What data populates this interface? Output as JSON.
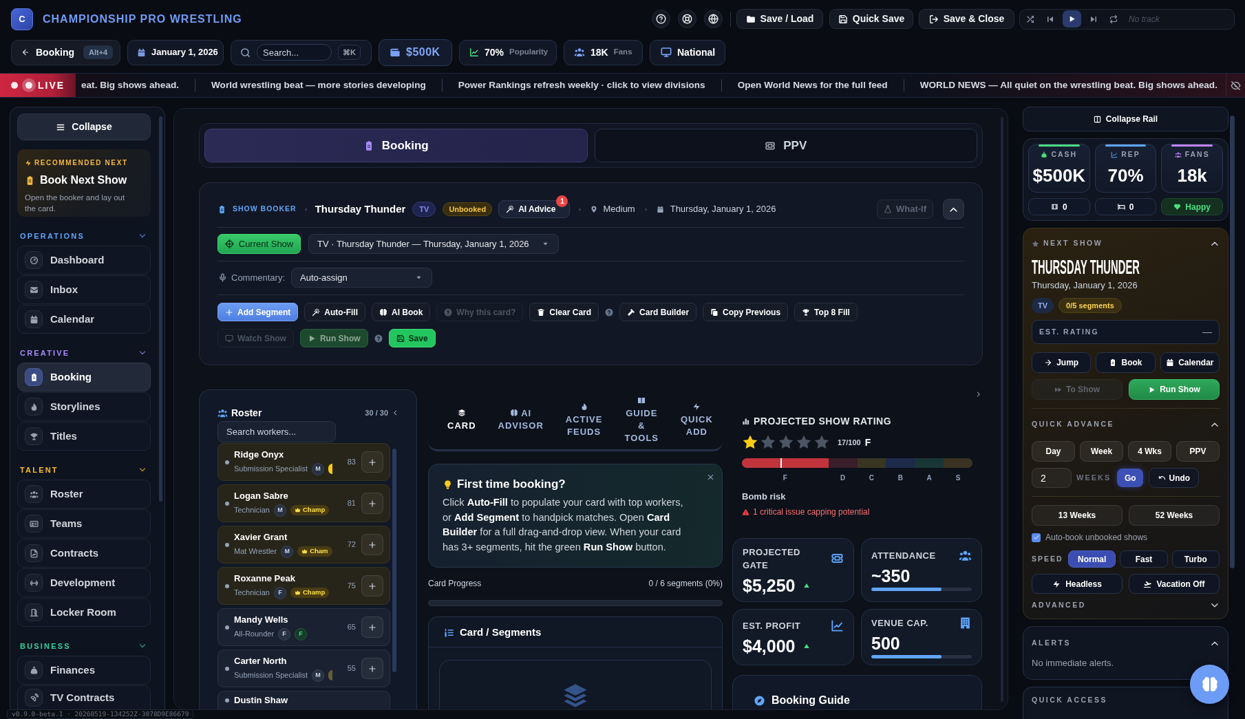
{
  "app": {
    "logo": "C",
    "title": "CHAMPIONSHIP PRO WRESTLING"
  },
  "toolbar": {
    "buttons": [
      {
        "label": "Save / Load"
      },
      {
        "label": "Quick Save"
      },
      {
        "label": "Save & Close"
      }
    ],
    "player": {
      "track": "No track"
    }
  },
  "nav": {
    "back": {
      "label": "Booking",
      "shortcut": "Alt+4"
    },
    "date": "January 1, 2026",
    "search": {
      "placeholder": "Search...",
      "shortcut": "⌘K"
    },
    "stats": [
      {
        "kind": "cash",
        "value": "$500K"
      },
      {
        "kind": "popularity",
        "value": "70%",
        "label": "Popularity"
      },
      {
        "kind": "fans",
        "value": "18K",
        "label": "Fans"
      },
      {
        "kind": "reach",
        "value": "National"
      }
    ]
  },
  "ticker": {
    "live": "LIVE",
    "items": [
      "eat. Big shows ahead.",
      "World wrestling beat — more stories developing",
      "Power Rankings refresh weekly · click to view divisions",
      "Open World News for the full feed",
      "WORLD NEWS — All quiet on the wrestling beat. Big shows ahead."
    ]
  },
  "sidebar": {
    "collapse": "Collapse",
    "recommended": {
      "eyebrow": "RECOMMENDED NEXT",
      "title": "Book Next Show",
      "text": "Open the booker and lay out the card."
    },
    "sections": [
      {
        "title": "OPERATIONS",
        "color": "#60a5fa",
        "items": [
          {
            "label": "Dashboard",
            "selected": false
          },
          {
            "label": "Inbox",
            "selected": false
          },
          {
            "label": "Calendar",
            "selected": false
          }
        ]
      },
      {
        "title": "CREATIVE",
        "color": "#a78bfa",
        "items": [
          {
            "label": "Booking",
            "selected": true
          },
          {
            "label": "Storylines",
            "selected": false
          },
          {
            "label": "Titles",
            "selected": false
          }
        ]
      },
      {
        "title": "TALENT",
        "color": "#fbbf24",
        "items": [
          {
            "label": "Roster",
            "selected": false
          },
          {
            "label": "Teams",
            "selected": false
          },
          {
            "label": "Contracts",
            "selected": false
          },
          {
            "label": "Development",
            "selected": false
          },
          {
            "label": "Locker Room",
            "selected": false
          }
        ]
      },
      {
        "title": "BUSINESS",
        "color": "#34d399",
        "items": [
          {
            "label": "Finances",
            "selected": false
          },
          {
            "label": "TV Contracts",
            "selected": false
          }
        ]
      }
    ],
    "version": "v0.9.0-beta.1 · 20260519-134252Z-3078D9E86679"
  },
  "main_tabs": [
    {
      "label": "Booking",
      "selected": true
    },
    {
      "label": "PPV",
      "selected": false
    }
  ],
  "show_booker": {
    "title": "SHOW BOOKER",
    "show_name": "Thursday Thunder",
    "type_badge": "TV",
    "status_badge": "Unbooked",
    "ai_advice": {
      "label": "AI Advice",
      "count": "1"
    },
    "venue": "Medium",
    "date": "Thursday, January 1, 2026",
    "what_if": "What-If",
    "expanded": true,
    "current_show": "Current Show",
    "show_select": "TV · Thursday Thunder — Thursday, January 1, 2026",
    "commentary": {
      "label": "Commentary:",
      "value": "Auto-assign"
    },
    "action_rows": [
      [
        {
          "kind": "primary",
          "label": "Add Segment"
        },
        {
          "kind": "plain",
          "label": "Auto-Fill"
        },
        {
          "kind": "plain",
          "label": "AI Book"
        },
        {
          "kind": "disabled",
          "label": "Why this card?"
        },
        {
          "kind": "plain",
          "label": "Clear Card"
        },
        {
          "kind": "help"
        },
        {
          "kind": "plain",
          "label": "Card Builder"
        },
        {
          "kind": "plain",
          "label": "Copy Previous"
        },
        {
          "kind": "plain",
          "label": "Top 8 Fill"
        }
      ],
      [
        {
          "kind": "disabled",
          "label": "Watch Show"
        },
        {
          "kind": "run",
          "label": "Run Show"
        },
        {
          "kind": "help"
        },
        {
          "kind": "save",
          "label": "Save"
        }
      ]
    ]
  },
  "roster": {
    "title": "Roster",
    "count": "30 / 30",
    "search_placeholder": "Search workers...",
    "workers": [
      {
        "name": "Ridge Onyx",
        "role": "Submission Specialist",
        "rating": "83",
        "champion": true,
        "tags": [
          {
            "kind": "gender",
            "label": "M"
          },
          {
            "kind": "edge",
            "color": "#facc15"
          }
        ]
      },
      {
        "name": "Logan Sabre",
        "role": "Technician",
        "rating": "81",
        "champion": true,
        "tags": [
          {
            "kind": "gender",
            "label": "M"
          },
          {
            "kind": "champ",
            "label": "Champ"
          }
        ]
      },
      {
        "name": "Xavier Grant",
        "role": "Mat Wrestler",
        "rating": "72",
        "champion": true,
        "tags": [
          {
            "kind": "gender",
            "label": "M"
          },
          {
            "kind": "champ",
            "label": "Cham"
          }
        ]
      },
      {
        "name": "Roxanne Peak",
        "role": "Technician",
        "rating": "75",
        "champion": true,
        "tags": [
          {
            "kind": "gender",
            "label": "F"
          },
          {
            "kind": "champ",
            "label": "Champ"
          }
        ]
      },
      {
        "name": "Mandy Wells",
        "role": "All-Rounder",
        "rating": "65",
        "champion": false,
        "tags": [
          {
            "kind": "gender",
            "label": "F"
          },
          {
            "kind": "face",
            "label": "F"
          }
        ]
      },
      {
        "name": "Carter North",
        "role": "Submission Specialist",
        "rating": "55",
        "champion": false,
        "tags": [
          {
            "kind": "gender",
            "label": "M"
          },
          {
            "kind": "edge",
            "color": "#6b5a3a"
          }
        ]
      },
      {
        "name": "Dustin Shaw",
        "champion": false
      }
    ]
  },
  "card_tabs": [
    {
      "label": "CARD",
      "selected": true
    },
    {
      "label": "AI ADVISOR",
      "selected": false
    },
    {
      "label": "ACTIVE FEUDS",
      "selected": false
    },
    {
      "label": "GUIDE & TOOLS",
      "selected": false
    },
    {
      "label": "QUICK ADD",
      "selected": false
    }
  ],
  "tip": {
    "title": "First time booking?",
    "text": "Click **Auto-Fill** to populate your card with top workers, or **Add Segment** to handpick matches. Open **Card Builder** for a full drag-and-drop view. When your card has 3+ segments, hit the green **Run Show** button."
  },
  "card_progress": {
    "label": "Card Progress",
    "value": "0 / 6 segments (0%)",
    "level": 0
  },
  "segments": {
    "title": "Card / Segments"
  },
  "rating": {
    "title": "PROJECTED SHOW RATING",
    "stars": 1,
    "score": "17/100",
    "grade": "F",
    "level": 0.17,
    "scale": [
      {
        "label": "F",
        "color": "#c2343c"
      },
      {
        "label": "D",
        "color": "#3a1e29"
      },
      {
        "label": "C",
        "color": "#383620"
      },
      {
        "label": "B",
        "color": "#1d2a4a"
      },
      {
        "label": "A",
        "color": "#193637"
      },
      {
        "label": "S",
        "color": "#3b3322"
      }
    ],
    "risk_title": "Bomb risk",
    "risk_warning": "1 critical issue capping potential"
  },
  "stat_cards": [
    {
      "kind": "trend",
      "label": "PROJECTED GATE",
      "value": "$5,250"
    },
    {
      "kind": "meter",
      "label": "ATTENDANCE",
      "value": "~350",
      "level": 0.7
    },
    {
      "kind": "trend",
      "label": "EST. PROFIT",
      "value": "$4,000"
    },
    {
      "kind": "meter",
      "label": "VENUE CAP.",
      "value": "500",
      "level": 0.7
    }
  ],
  "guide": {
    "title": "Booking Guide"
  },
  "rail": {
    "collapse": "Collapse Rail",
    "tiles": [
      {
        "label": "CASH",
        "value": "$500K",
        "color": "#4ade80"
      },
      {
        "label": "REP",
        "value": "70%",
        "color": "#60a5fa"
      },
      {
        "label": "FANS",
        "value": "18k",
        "color": "#c084fc"
      }
    ],
    "mini": [
      {
        "kind": "plain",
        "value": "0"
      },
      {
        "kind": "plain",
        "value": "0"
      },
      {
        "kind": "mood",
        "value": "Happy"
      }
    ],
    "next_show": {
      "eyebrow": "NEXT SHOW",
      "expanded": true,
      "title": "THURSDAY THUNDER",
      "date": "Thursday, January 1, 2026",
      "badges": [
        {
          "kind": "type",
          "label": "TV"
        },
        {
          "kind": "count",
          "label": "0/5 segments"
        }
      ],
      "rating": {
        "label": "EST. RATING",
        "value": "—"
      },
      "links": [
        {
          "label": "Jump"
        },
        {
          "label": "Book"
        },
        {
          "label": "Calendar"
        }
      ],
      "actions": [
        {
          "label": "To Show",
          "disabled": true
        },
        {
          "label": "Run Show",
          "disabled": false
        }
      ]
    },
    "quick_advance": {
      "title": "QUICK ADVANCE",
      "expanded": true,
      "steps": [
        "Day",
        "Week",
        "4 Wks",
        "PPV"
      ],
      "custom": {
        "value": "2",
        "unit": "WEEKS",
        "go": "Go",
        "undo": "Undo"
      },
      "long": [
        "13 Weeks",
        "52 Weeks"
      ],
      "auto_book": {
        "label": "Auto-book unbooked shows",
        "checked": true
      },
      "speed": {
        "label": "SPEED",
        "options": [
          {
            "label": "Normal",
            "selected": true
          },
          {
            "label": "Fast",
            "selected": false
          },
          {
            "label": "Turbo",
            "selected": false
          }
        ]
      },
      "toggles": [
        {
          "label": "Headless"
        },
        {
          "label": "Vacation Off"
        }
      ],
      "advanced": {
        "title": "ADVANCED",
        "expanded": false
      }
    },
    "alerts": {
      "title": "ALERTS",
      "expanded": true,
      "text": "No immediate alerts."
    },
    "quick_access": {
      "title": "QUICK ACCESS"
    }
  }
}
